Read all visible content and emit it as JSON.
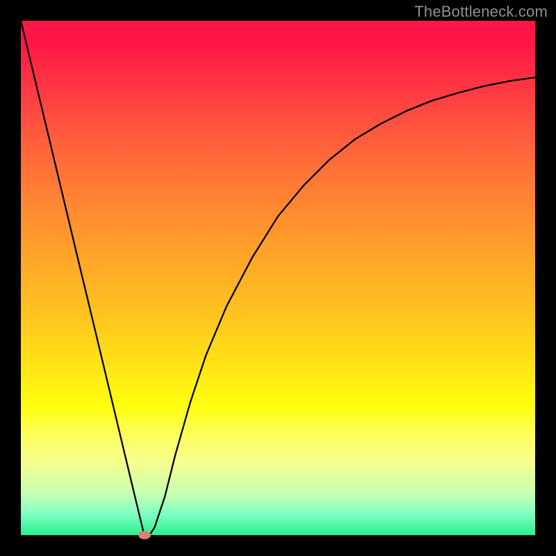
{
  "watermark": "TheBottleneck.com",
  "chart_data": {
    "type": "line",
    "title": "",
    "xlabel": "",
    "ylabel": "",
    "xlim": [
      0,
      100
    ],
    "ylim": [
      0,
      100
    ],
    "grid": false,
    "series": [
      {
        "name": "curve",
        "x": [
          0,
          5,
          10,
          15,
          20,
          23,
          24,
          25,
          26,
          28,
          30,
          33,
          36,
          40,
          45,
          50,
          55,
          60,
          65,
          70,
          75,
          80,
          85,
          90,
          95,
          100
        ],
        "y": [
          100,
          79.2,
          58.3,
          37.5,
          16.6,
          4.1,
          0,
          0,
          1.5,
          7.5,
          15.5,
          26.0,
          35.0,
          44.5,
          54.0,
          62.0,
          68.0,
          73.0,
          77.0,
          80.0,
          82.5,
          84.5,
          86.0,
          87.3,
          88.3,
          89.0
        ]
      }
    ],
    "marker": {
      "x": 24,
      "y": 0
    }
  }
}
